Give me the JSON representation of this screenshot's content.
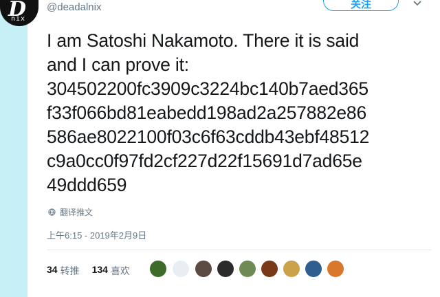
{
  "author": {
    "avatar_text": "D",
    "avatar_subtext": "nix",
    "handle": "@deadalnix"
  },
  "follow_button": "关注",
  "tweet": {
    "lines": [
      "I am Satoshi Nakamoto. There it is said",
      "and I can prove it:",
      "304502200fc3909c3224bc140b7aed365",
      "f33f066bd81eabedd198ad2a257882e86",
      "586ae8022100f03c6f63cddb43ebf48512",
      "c9a0cc0f97fd2cf227d22f15691d7ad65e",
      "49ddd659"
    ]
  },
  "translate_label": "翻译推文",
  "timestamp": "上午6:15 - 2019年2月9日",
  "stats": {
    "retweets_count": "34",
    "retweets_label": "转推",
    "likes_count": "134",
    "likes_label": "喜欢"
  },
  "likers": [
    {
      "icon": "avatar-1",
      "color": "#3d6b2a"
    },
    {
      "icon": "avatar-2",
      "color": "#e8eef2"
    },
    {
      "icon": "avatar-3",
      "color": "#5a4a40"
    },
    {
      "icon": "avatar-4",
      "color": "#2b2b2b"
    },
    {
      "icon": "avatar-5",
      "color": "#6f8a55"
    },
    {
      "icon": "avatar-6",
      "color": "#7a3a1a"
    },
    {
      "icon": "avatar-7",
      "color": "#c9a24a"
    },
    {
      "icon": "avatar-8",
      "color": "#2f5f8f"
    },
    {
      "icon": "avatar-9",
      "color": "#d9772b"
    }
  ],
  "colors": {
    "accent": "#1da1f2",
    "secondary_text": "#657786",
    "side_bar": "#c6f0f6"
  }
}
